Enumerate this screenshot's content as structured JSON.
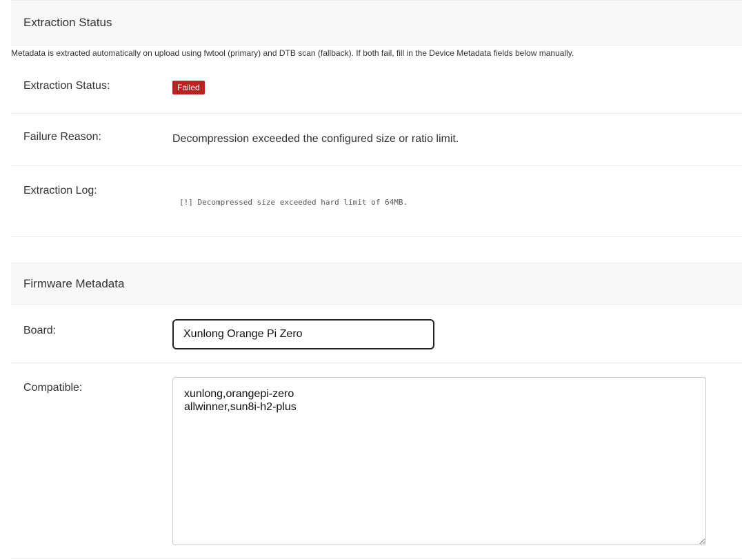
{
  "extraction": {
    "section_title": "Extraction Status",
    "description": "Metadata is extracted automatically on upload using fwtool (primary) and DTB scan (fallback). If both fail, fill in the Device Metadata fields below manually.",
    "status_label": "Extraction Status:",
    "status_value": "Failed",
    "status_color": "#ba2121",
    "failure_label": "Failure Reason:",
    "failure_value": "Decompression exceeded the configured size or ratio limit.",
    "log_label": "Extraction Log:",
    "log_value": "[!] Decompressed size exceeded hard limit of 64MB."
  },
  "metadata": {
    "section_title": "Firmware Metadata",
    "board_label": "Board:",
    "board_value": "Xunlong Orange Pi Zero",
    "compatible_label": "Compatible:",
    "compatible_value": "xunlong,orangepi-zero\nallwinner,sun8i-h2-plus"
  }
}
